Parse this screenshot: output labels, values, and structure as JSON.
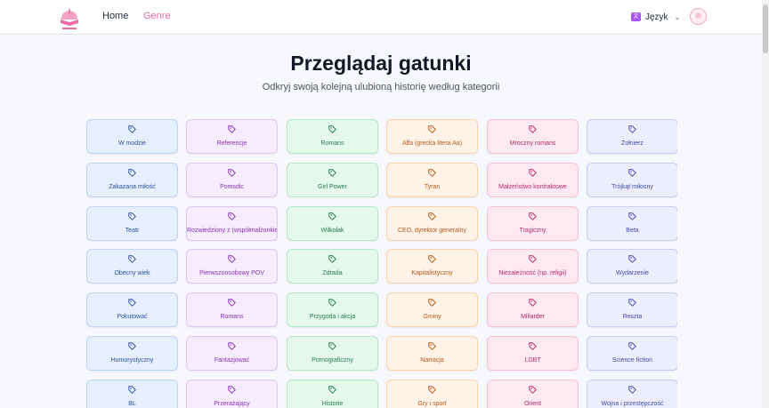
{
  "nav": {
    "home_label": "Home",
    "genre_label": "Genre",
    "language_label": "Język",
    "language_icon": "translate-icon",
    "avatar_icon": "user-avatar-icon"
  },
  "page": {
    "title": "Przeglądaj gatunki",
    "subtitle": "Odkryj swoją kolejną ulubioną historię według kategorii"
  },
  "genres": [
    [
      "W modzie",
      "Referencje",
      "Romans",
      "Alfa (grecka litera Aα)",
      "Mroczny romans",
      "Żołnierz"
    ],
    [
      "Zakazana miłość",
      "Pomsdic",
      "Girl Power",
      "Tyran",
      "Małżeństwo kontraktowe",
      "Trójkąt miłosny"
    ],
    [
      "Teatr",
      "Rozwiedziony z (współmałżonkie",
      "Wilkołak",
      "CEO, dyrektor generalny",
      "Tragiczny",
      "Beta"
    ],
    [
      "Obecny wiek",
      "Pierwszoosobowy POV",
      "Zdrada",
      "Kapitalistyczny",
      "Niezależność (np. religii)",
      "Wydarzenie"
    ],
    [
      "Pokutować",
      "Romans",
      "Przygoda i akcja",
      "Gminy",
      "Miliarder",
      "Reszta"
    ],
    [
      "Humorystyczny",
      "Fantazjować",
      "Pornograficzny",
      "Narracja",
      "LGBT",
      "Science fiction"
    ],
    [
      "BL",
      "Przerażający",
      "Historie",
      "Gry i sport",
      "Orient",
      "Wojna i przestępczość"
    ]
  ],
  "colors": {
    "brand_pink": "#ec6aa6",
    "column_palette": [
      "blue",
      "purple",
      "green",
      "orange",
      "pink",
      "indigo"
    ]
  }
}
